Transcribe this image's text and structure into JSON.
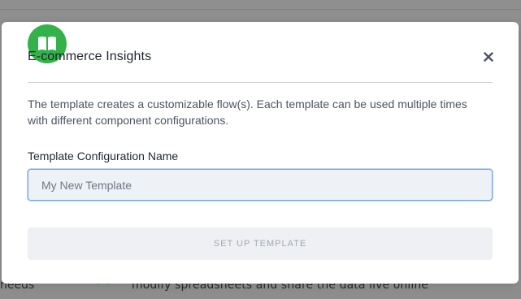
{
  "background": {
    "bottom_text": "modify spreadsheets and share the data live online",
    "bottom_left_text": "needs"
  },
  "modal": {
    "title": "E-commerce Insights",
    "app_icon": "book-icon",
    "close_icon": "close-icon",
    "description": "The template creates a customizable flow(s). Each template can be used multiple times with different component configurations.",
    "field_label": "Template Configuration Name",
    "name_input": {
      "value": "",
      "placeholder": "My New Template"
    },
    "setup_button_label": "SET UP TEMPLATE",
    "setup_button_disabled": true
  },
  "colors": {
    "badge": "#34b24a",
    "input_focus_border": "#79a9e4",
    "disabled_button_bg": "#eef0f3",
    "disabled_button_text": "#a3a9b2"
  }
}
